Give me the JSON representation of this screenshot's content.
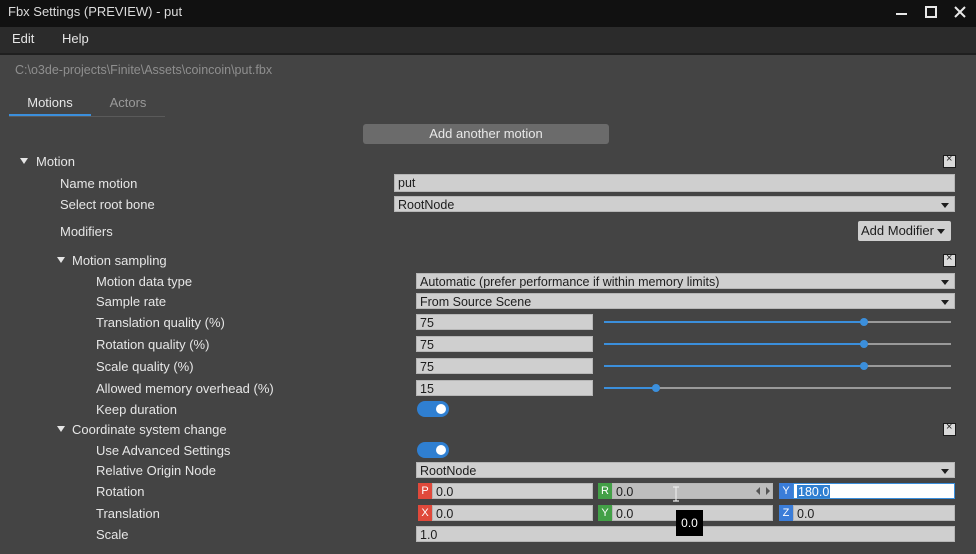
{
  "window": {
    "title": "Fbx Settings (PREVIEW) - put"
  },
  "menu": {
    "edit": "Edit",
    "help": "Help"
  },
  "file_path": "C:\\o3de-projects\\Finite\\Assets\\coincoin\\put.fbx",
  "tabs": [
    {
      "label": "Motions",
      "active": true
    },
    {
      "label": "Actors",
      "active": false
    }
  ],
  "add_motion_label": "Add another motion",
  "motion": {
    "header": "Motion",
    "name_label": "Name motion",
    "name_value": "put",
    "root_bone_label": "Select root bone",
    "root_bone_value": "RootNode",
    "modifiers_label": "Modifiers",
    "add_modifier_label": "Add Modifier"
  },
  "sampling": {
    "header": "Motion sampling",
    "data_type_label": "Motion data type",
    "data_type_value": "Automatic (prefer performance if within memory limits)",
    "sample_rate_label": "Sample rate",
    "sample_rate_value": "From Source Scene",
    "translation_label": "Translation quality (%)",
    "translation_value": "75",
    "translation_level": 0.75,
    "rotation_label": "Rotation quality (%)",
    "rotation_value": "75",
    "rotation_level": 0.75,
    "scale_label": "Scale quality (%)",
    "scale_value": "75",
    "scale_level": 0.75,
    "memory_label": "Allowed memory overhead (%)",
    "memory_value": "15",
    "memory_level": 0.15,
    "keep_duration_label": "Keep duration",
    "keep_duration_on": true
  },
  "coordinate": {
    "header": "Coordinate system change",
    "advanced_label": "Use Advanced Settings",
    "advanced_on": true,
    "origin_label": "Relative Origin Node",
    "origin_value": "RootNode",
    "rotation_label": "Rotation",
    "rotation": {
      "p_tag": "P",
      "p": "0.0",
      "r_tag": "R",
      "r": "0.0",
      "y_tag": "Y",
      "y": "180.0"
    },
    "translation_label": "Translation",
    "translation": {
      "x_tag": "X",
      "x": "0.0",
      "y_tag": "Y",
      "y": "0.0",
      "z_tag": "Z",
      "z": "0.0"
    },
    "scale_label": "Scale",
    "scale_value": "1.0",
    "tooltip": "0.0"
  },
  "colors": {
    "accent": "#3b8fdc",
    "x_red": "#e0493b",
    "y_green": "#43a047",
    "z_blue": "#3b7dd8"
  }
}
